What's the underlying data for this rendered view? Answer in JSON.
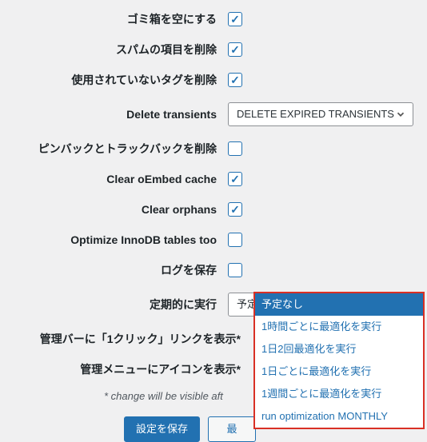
{
  "rows": {
    "empty_trash": {
      "label": "ゴミ箱を空にする",
      "checked": true
    },
    "delete_spam": {
      "label": "スパムの項目を削除",
      "checked": true
    },
    "delete_unused_tags": {
      "label": "使用されていないタグを削除",
      "checked": true
    },
    "delete_transients": {
      "label": "Delete transients",
      "value": "DELETE EXPIRED TRANSIENTS"
    },
    "delete_pingbacks": {
      "label": "ピンバックとトラックバックを削除",
      "checked": false
    },
    "clear_oembed": {
      "label": "Clear oEmbed cache",
      "checked": true
    },
    "clear_orphans": {
      "label": "Clear orphans",
      "checked": true
    },
    "optimize_innodb": {
      "label": "Optimize InnoDB tables too",
      "checked": false
    },
    "save_log": {
      "label": "ログを保存",
      "checked": false
    },
    "schedule": {
      "label": "定期的に実行",
      "value": "予定なし"
    },
    "oneclick": {
      "label": "管理バーに「1クリック」リンクを表示*"
    },
    "menu_icon": {
      "label": "管理メニューにアイコンを表示*"
    }
  },
  "schedule_options": [
    "予定なし",
    "1時間ごとに最適化を実行",
    "1日2回最適化を実行",
    "1日ごとに最適化を実行",
    "1週間ごとに最適化を実行",
    "run optimization MONTHLY"
  ],
  "note": "* change will be visible aft",
  "buttons": {
    "save": "設定を保存",
    "secondary": "最"
  }
}
